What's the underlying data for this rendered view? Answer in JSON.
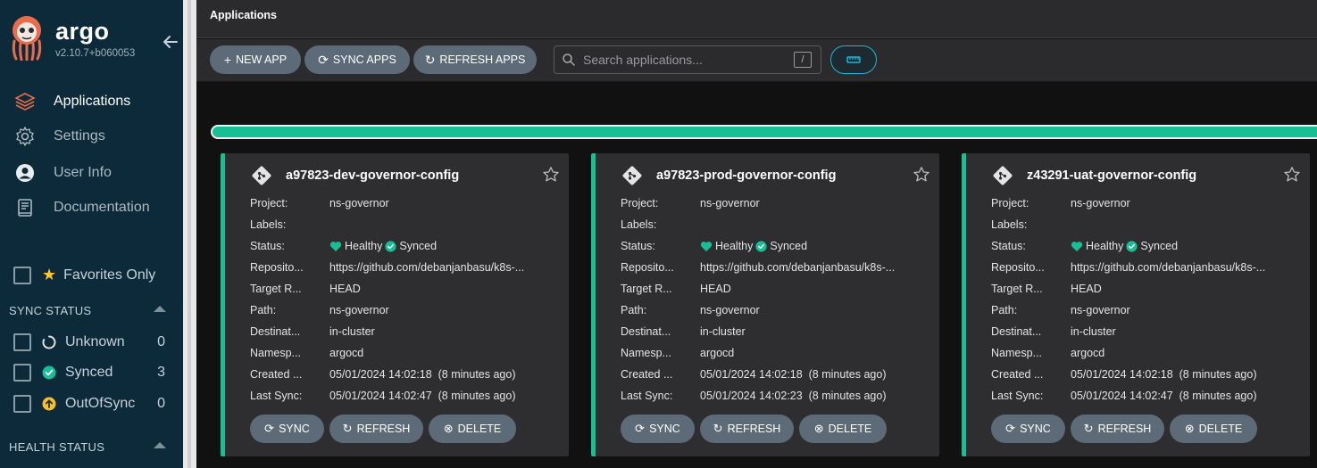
{
  "sidebar": {
    "brand": "argo",
    "version": "v2.10.7+b060053",
    "nav": [
      {
        "label": "Applications",
        "icon": "stack-icon"
      },
      {
        "label": "Settings",
        "icon": "gear-icon"
      },
      {
        "label": "User Info",
        "icon": "user-icon"
      },
      {
        "label": "Documentation",
        "icon": "book-icon"
      }
    ],
    "favorites_label": "Favorites Only",
    "sync_status": {
      "title": "SYNC STATUS",
      "items": [
        {
          "label": "Unknown",
          "count": "0"
        },
        {
          "label": "Synced",
          "count": "3"
        },
        {
          "label": "OutOfSync",
          "count": "0"
        }
      ]
    },
    "health_status": {
      "title": "HEALTH STATUS"
    }
  },
  "header": {
    "title": "Applications"
  },
  "toolbar": {
    "new_app": "NEW APP",
    "sync_apps": "SYNC APPS",
    "refresh_apps": "REFRESH APPS",
    "search_placeholder": "Search applications...",
    "search_shortcut": "/"
  },
  "progress": {
    "fraction": 1.0,
    "color": "#18be94"
  },
  "labels": {
    "project": "Project:",
    "labels": "Labels:",
    "status": "Status:",
    "repo": "Reposito...",
    "target": "Target R...",
    "path": "Path:",
    "dest": "Destinat...",
    "namespace": "Namesp...",
    "created": "Created ...",
    "last_sync": "Last Sync:"
  },
  "card_buttons": {
    "sync": "SYNC",
    "refresh": "REFRESH",
    "delete": "DELETE"
  },
  "apps": [
    {
      "name": "a97823-dev-governor-config",
      "project": "ns-governor",
      "labels": "",
      "health": "Healthy",
      "sync": "Synced",
      "repo": "https://github.com/debanjanbasu/k8s-...",
      "target": "HEAD",
      "path": "ns-governor",
      "dest": "in-cluster",
      "namespace": "argocd",
      "created": "05/01/2024 14:02:18  (8 minutes ago)",
      "last_sync": "05/01/2024 14:02:47  (8 minutes ago)"
    },
    {
      "name": "a97823-prod-governor-config",
      "project": "ns-governor",
      "labels": "",
      "health": "Healthy",
      "sync": "Synced",
      "repo": "https://github.com/debanjanbasu/k8s-...",
      "target": "HEAD",
      "path": "ns-governor",
      "dest": "in-cluster",
      "namespace": "argocd",
      "created": "05/01/2024 14:02:18  (8 minutes ago)",
      "last_sync": "05/01/2024 14:02:23  (8 minutes ago)"
    },
    {
      "name": "z43291-uat-governor-config",
      "project": "ns-governor",
      "labels": "",
      "health": "Healthy",
      "sync": "Synced",
      "repo": "https://github.com/debanjanbasu/k8s-...",
      "target": "HEAD",
      "path": "ns-governor",
      "dest": "in-cluster",
      "namespace": "argocd",
      "created": "05/01/2024 14:02:18  (8 minutes ago)",
      "last_sync": "05/01/2024 14:02:47  (8 minutes ago)"
    }
  ],
  "colors": {
    "accent": "#18be94",
    "sidebar": "#0c2a39",
    "button": "#5c6b77",
    "star": "#ffc72c",
    "outofsync": "#f4c030"
  }
}
